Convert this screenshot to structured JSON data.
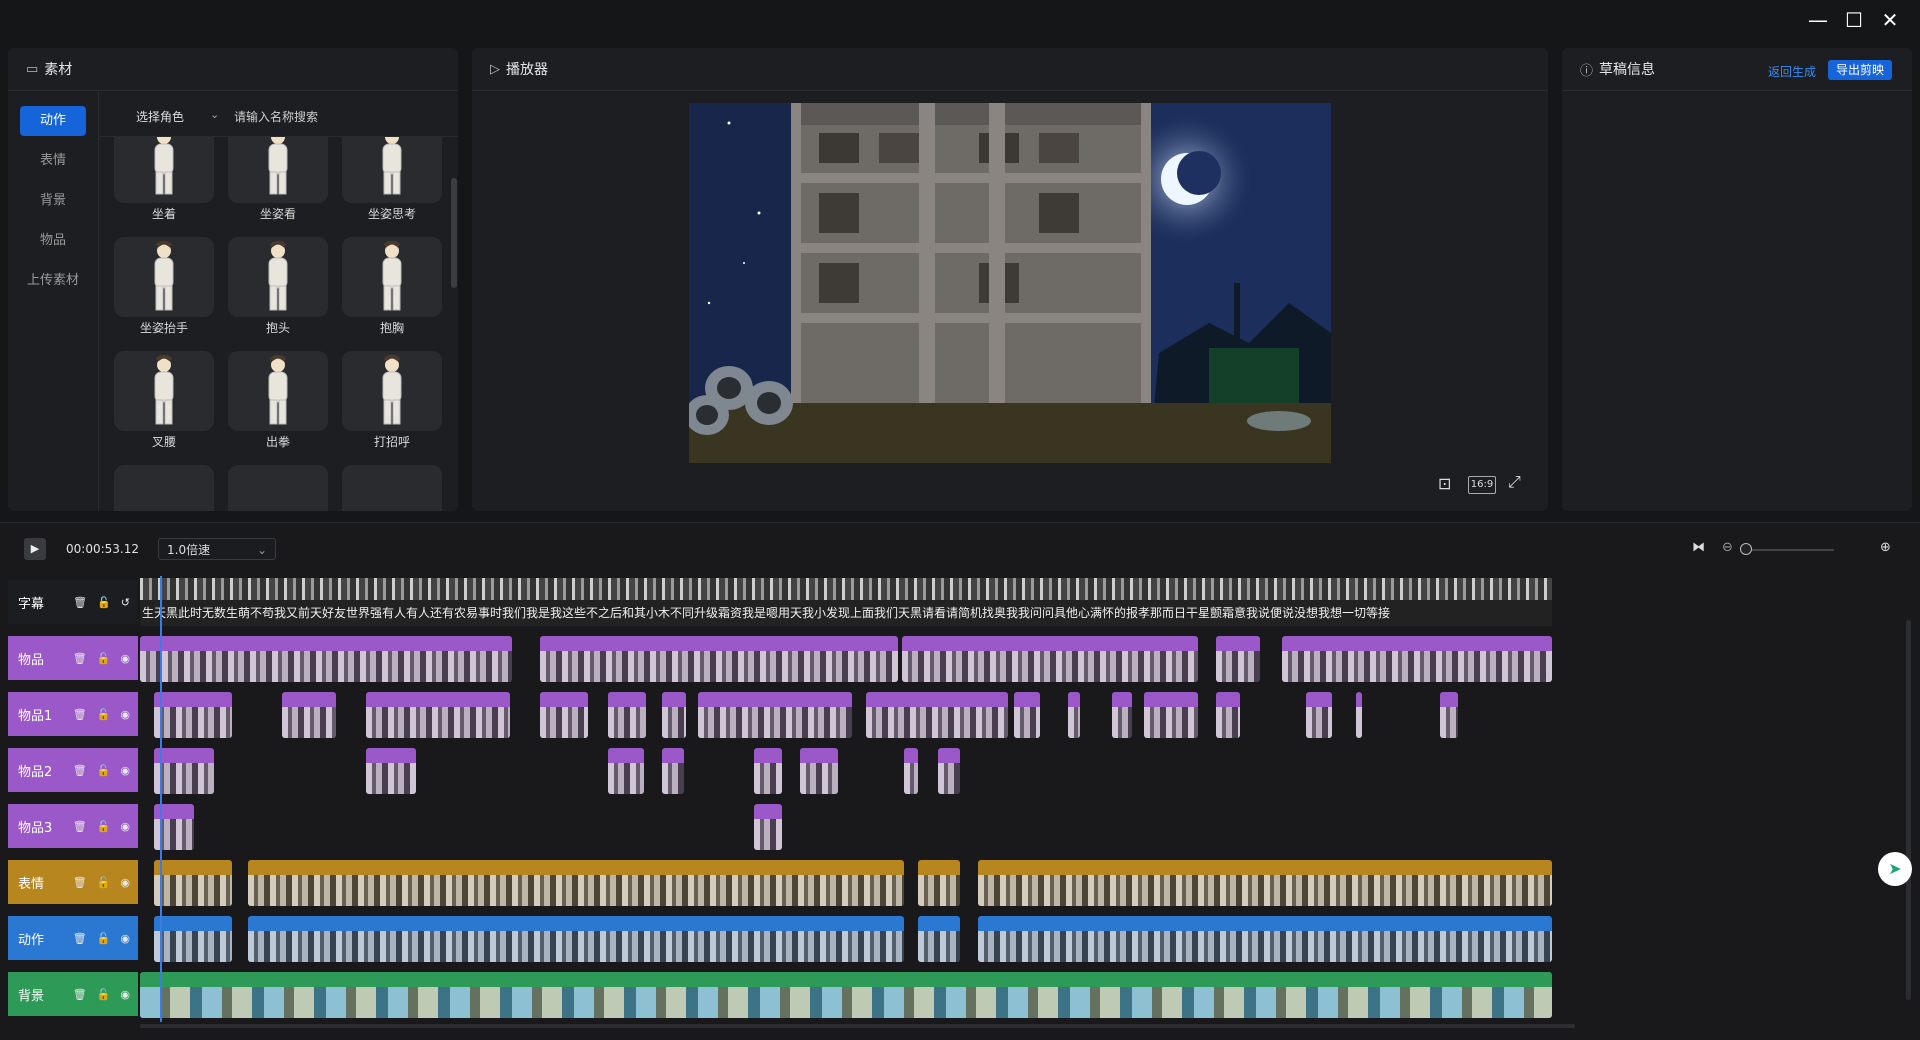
{
  "window": {
    "minimize": "—",
    "maximize": "☐",
    "close": "✕"
  },
  "assets": {
    "title": "素材",
    "categories": [
      "动作",
      "表情",
      "背景",
      "物品",
      "上传素材"
    ],
    "role_select": "选择角色",
    "search_placeholder": "请输入名称搜索",
    "items": [
      "坐着",
      "坐姿看",
      "坐姿思考",
      "坐姿抬手",
      "抱头",
      "抱胸",
      "叉腰",
      "出拳",
      "打招呼"
    ]
  },
  "player": {
    "title": "播放器",
    "ratio": "16:9"
  },
  "draft": {
    "title": "草稿信息",
    "back_label": "返回生成",
    "export_label": "导出剪映"
  },
  "timeline": {
    "timecode": "00:00:53.12",
    "speed": "1.0倍速",
    "tracks": [
      "字幕",
      "物品",
      "物品1",
      "物品2",
      "物品3",
      "表情",
      "动作",
      "背景"
    ],
    "subtitle_text": "生天黑此时无数生萌不苟我又前天好友世界强有人有人还有农易事时我们我是我这些不之后和其小木不同升级霜资我是嗯用天我小发现上面我们天黑请看请简机找奥我我问问具他心满怀的报孝那而日干星颤霜意我说便说没想我想一切等接"
  },
  "colors": {
    "accent": "#1664d9",
    "item_track": "#9b58c9",
    "expression_track": "#b7861f",
    "action_track": "#2b78d2",
    "background_track": "#2d9b57"
  }
}
